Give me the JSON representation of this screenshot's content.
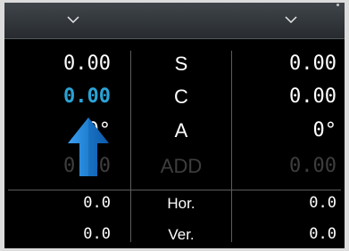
{
  "top_dropdowns": {
    "left": {
      "icon": "chevron-down-icon"
    },
    "right": {
      "icon": "chevron-down-icon"
    }
  },
  "rows": {
    "sphere": {
      "left": "0.00",
      "label": "S",
      "right": "0.00"
    },
    "cylinder": {
      "left": "0.00",
      "label": "C",
      "right": "0.00"
    },
    "axis": {
      "left": "0°",
      "label": "A",
      "right": "0°"
    },
    "add": {
      "left": "0.00",
      "label": "ADD",
      "right": "0.00"
    },
    "horizontal": {
      "left": "0.0",
      "label": "Hor.",
      "right": "0.0"
    },
    "vertical": {
      "left": "0.0",
      "label": "Ver.",
      "right": "0.0"
    }
  },
  "selected_field_arrow": {
    "icon": "arrow-up-icon",
    "color": "#1f7fd1"
  },
  "colors": {
    "background": "#000000",
    "text": "#ffffff",
    "selected_value": "#2aa3d6",
    "disabled": "#3e3e3e",
    "divider": "#5c5c5c"
  }
}
